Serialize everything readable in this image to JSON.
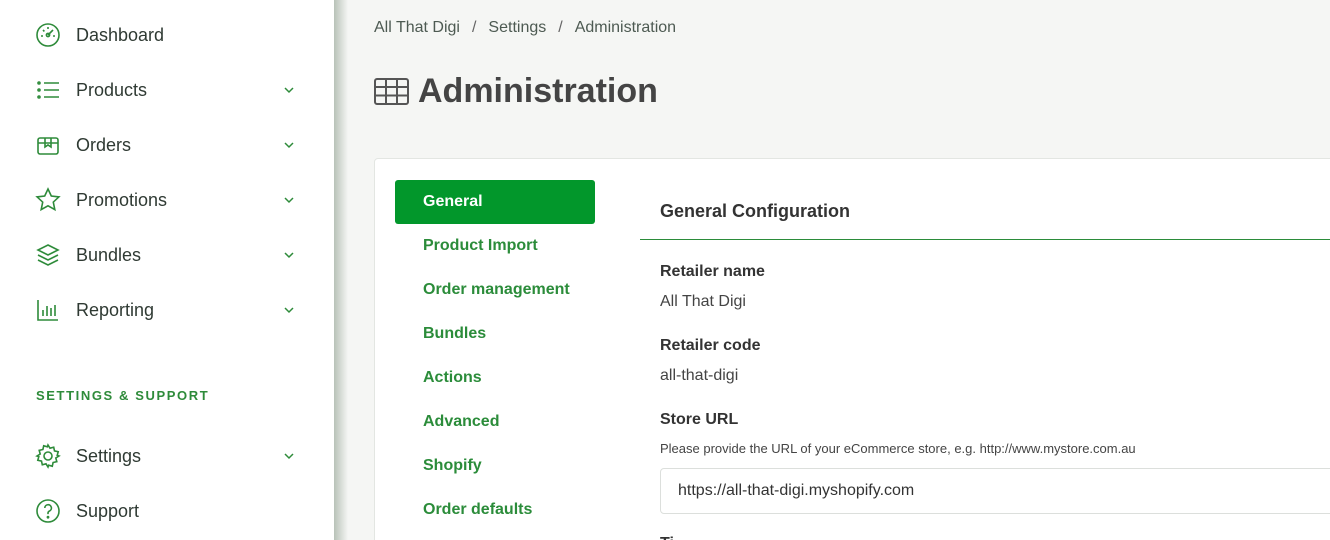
{
  "sidebar": {
    "items": [
      {
        "label": "Dashboard",
        "icon": "dashboard-gauge-icon"
      },
      {
        "label": "Products",
        "icon": "list-icon"
      },
      {
        "label": "Orders",
        "icon": "box-icon"
      },
      {
        "label": "Promotions",
        "icon": "star-icon"
      },
      {
        "label": "Bundles",
        "icon": "layers-icon"
      },
      {
        "label": "Reporting",
        "icon": "bar-chart-icon"
      }
    ],
    "section_title": "SETTINGS & SUPPORT",
    "support_items": [
      {
        "label": "Settings",
        "icon": "gear-icon"
      },
      {
        "label": "Support",
        "icon": "help-circle-icon"
      }
    ]
  },
  "breadcrumb": {
    "items": [
      "All That Digi",
      "Settings",
      "Administration"
    ],
    "separator": "/"
  },
  "page": {
    "title": "Administration",
    "icon": "table-icon"
  },
  "tabs": [
    {
      "label": "General",
      "active": true
    },
    {
      "label": "Product Import"
    },
    {
      "label": "Order management"
    },
    {
      "label": "Bundles"
    },
    {
      "label": "Actions"
    },
    {
      "label": "Advanced"
    },
    {
      "label": "Shopify"
    },
    {
      "label": "Order defaults"
    }
  ],
  "config": {
    "title": "General Configuration",
    "retailer_name_label": "Retailer name",
    "retailer_name_value": "All That Digi",
    "retailer_code_label": "Retailer code",
    "retailer_code_value": "all-that-digi",
    "store_url_label": "Store URL",
    "store_url_help": "Please provide the URL of your eCommerce store, e.g. http://www.mystore.com.au",
    "store_url_value": "https://all-that-digi.myshopify.com",
    "next_label_partial": "Ti"
  },
  "colors": {
    "accent": "#02972b",
    "accent_text": "#2b8c3a"
  }
}
